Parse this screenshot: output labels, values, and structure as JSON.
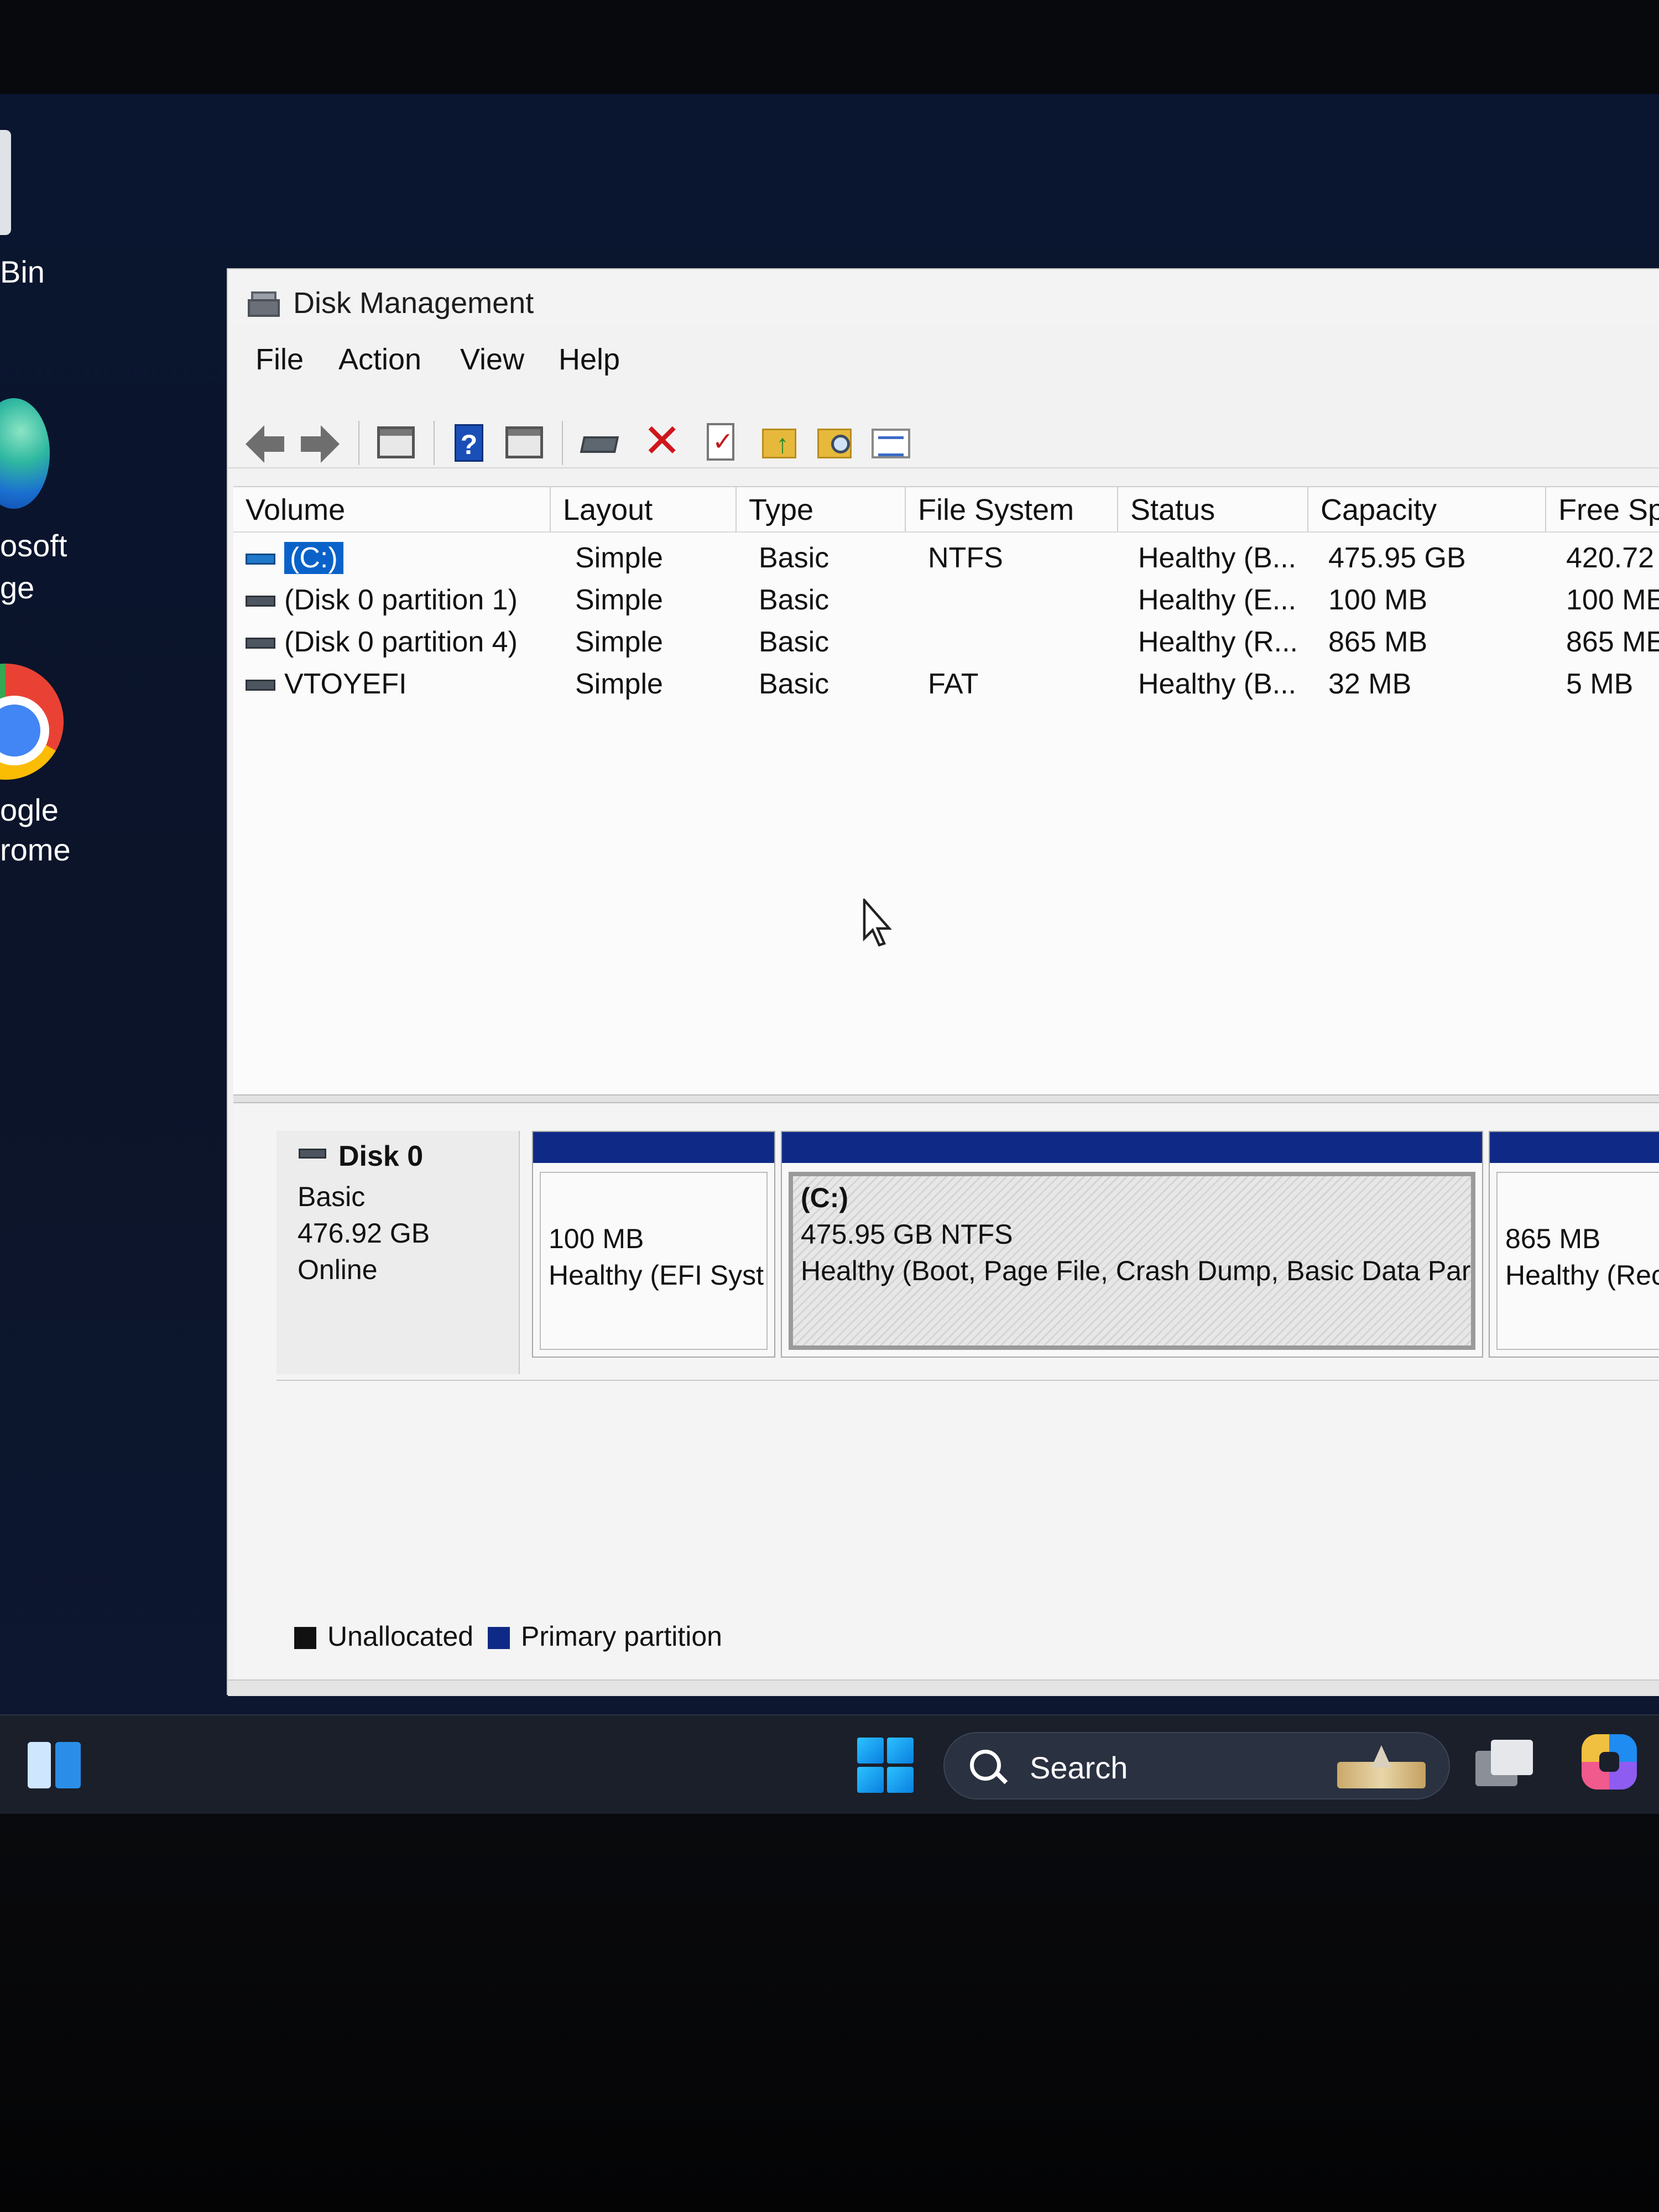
{
  "desktop": {
    "icons": [
      {
        "label": "Bin"
      },
      {
        "label_line1": "osoft",
        "label_line2": "ge"
      },
      {
        "label_line1": "ogle",
        "label_line2": "rome"
      }
    ]
  },
  "window": {
    "title": "Disk Management",
    "menu": [
      "File",
      "Action",
      "View",
      "Help"
    ],
    "toolbar": {
      "icons": [
        "back-icon",
        "forward-icon",
        "show-hide-console-icon",
        "help-icon",
        "show-hide-action-pane-icon",
        "connect-disk-icon",
        "delete-icon",
        "properties-icon",
        "folder-up-icon",
        "folder-search-icon",
        "list-view-icon"
      ]
    }
  },
  "volume_table": {
    "columns": [
      "Volume",
      "Layout",
      "Type",
      "File System",
      "Status",
      "Capacity",
      "Free Sp"
    ],
    "rows": [
      {
        "volume": "(C:)",
        "layout": "Simple",
        "type": "Basic",
        "file_system": "NTFS",
        "status": "Healthy (B...",
        "capacity": "475.95 GB",
        "free": "420.72",
        "selected": true
      },
      {
        "volume": "(Disk 0 partition 1)",
        "layout": "Simple",
        "type": "Basic",
        "file_system": "",
        "status": "Healthy (E...",
        "capacity": "100 MB",
        "free": "100 ME"
      },
      {
        "volume": "(Disk 0 partition 4)",
        "layout": "Simple",
        "type": "Basic",
        "file_system": "",
        "status": "Healthy (R...",
        "capacity": "865 MB",
        "free": "865 ME"
      },
      {
        "volume": "VTOYEFI",
        "layout": "Simple",
        "type": "Basic",
        "file_system": "FAT",
        "status": "Healthy (B...",
        "capacity": "32 MB",
        "free": "5 MB"
      }
    ]
  },
  "disk_view": {
    "disk": {
      "name": "Disk 0",
      "type": "Basic",
      "size": "476.92 GB",
      "state": "Online"
    },
    "partitions": [
      {
        "title": "",
        "line1": "100 MB",
        "line2": "Healthy (EFI Syst"
      },
      {
        "title": "(C:)",
        "line1": "475.95 GB NTFS",
        "line2": "Healthy (Boot, Page File, Crash Dump, Basic Data Par"
      },
      {
        "title": "",
        "line1": "865 MB",
        "line2": "Healthy (Rec"
      }
    ],
    "legend": [
      {
        "label": "Unallocated",
        "color": "#111111"
      },
      {
        "label": "Primary partition",
        "color": "#0f2a86"
      }
    ]
  },
  "taskbar": {
    "search_label": "Search"
  },
  "colors": {
    "partition_bar": "#0f2a86",
    "selection": "#0a62c9",
    "taskbar_bg": "#1a1f2a"
  }
}
